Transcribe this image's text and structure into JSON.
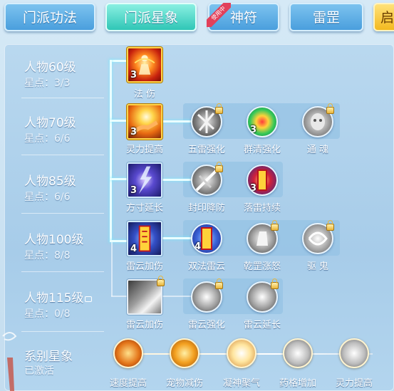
{
  "tabs": [
    {
      "label": "门派功法",
      "active": false
    },
    {
      "label": "门派星象",
      "active": true
    },
    {
      "label": "神符",
      "active": false,
      "badge": "使用中"
    },
    {
      "label": "雷罡",
      "active": false
    },
    {
      "label": "启",
      "active": false
    }
  ],
  "tiers": [
    {
      "title": "人物60级",
      "points": "星点：3/3"
    },
    {
      "title": "人物70级",
      "points": "星点：6/6"
    },
    {
      "title": "人物85级",
      "points": "星点：6/6"
    },
    {
      "title": "人物100级",
      "points": "星点：8/8"
    },
    {
      "title": "人物115级",
      "points": "星点：0/8",
      "locked": true
    }
  ],
  "skills": {
    "s60": {
      "label": "法 伤",
      "level": "3"
    },
    "s70a": {
      "label": "灵力提高",
      "level": "3"
    },
    "s70b": {
      "label": "五雷强化"
    },
    "s70c": {
      "label": "群清强化",
      "level": "3"
    },
    "s70d": {
      "label": "通 魂"
    },
    "s85a": {
      "label": "方寸延长",
      "level": "3"
    },
    "s85b": {
      "label": "封印降防"
    },
    "s85c": {
      "label": "落雷持续",
      "level": "3"
    },
    "s100a": {
      "label": "雷云加伤",
      "level": "4"
    },
    "s100b": {
      "label": "双法雷云",
      "level": "4"
    },
    "s100c": {
      "label": "乾罡涨怒"
    },
    "s100d": {
      "label": "驱 鬼"
    },
    "s115a": {
      "label": "雷云加伤"
    },
    "s115b": {
      "label": "雷云强化"
    },
    "s115c": {
      "label": "雷云延长"
    }
  },
  "series": {
    "title": "系别星象",
    "status": "已激活",
    "items": [
      "速度提高",
      "宠物减伤",
      "凝神聚气",
      "药格增加",
      "灵力提高"
    ]
  }
}
